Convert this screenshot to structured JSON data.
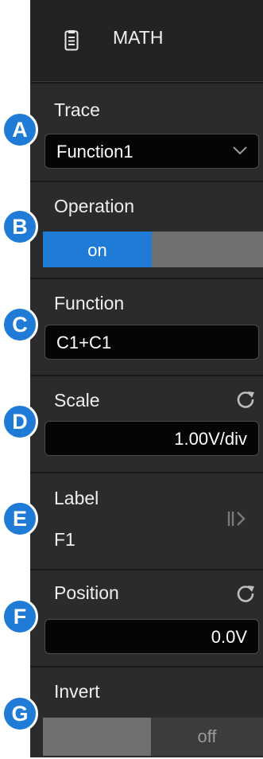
{
  "header": {
    "title": "MATH",
    "icon": "document-icon"
  },
  "trace": {
    "label": "Trace",
    "value": "Function1",
    "badge": "A"
  },
  "operation": {
    "label": "Operation",
    "on_label": "on",
    "badge": "B",
    "on_color": "#1f7bd6",
    "off_color": "#707070"
  },
  "function": {
    "label": "Function",
    "value": "C1+C1",
    "badge": "C"
  },
  "scale": {
    "label": "Scale",
    "value": "1.00V/div",
    "badge": "D"
  },
  "label_section": {
    "label": "Label",
    "value": "F1",
    "badge": "E"
  },
  "position": {
    "label": "Position",
    "value": "0.0V",
    "badge": "F"
  },
  "invert": {
    "label": "Invert",
    "off_label": "off",
    "badge": "G"
  },
  "colors": {
    "panel": "#2b2b2b",
    "badge": "#1f7bd6",
    "field": "#050505"
  }
}
